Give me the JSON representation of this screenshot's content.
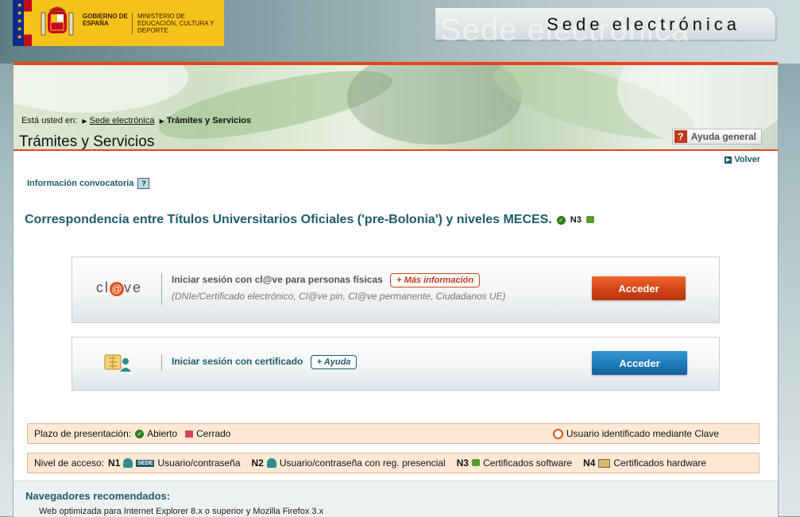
{
  "header": {
    "gobierno": "GOBIERNO DE ESPAÑA",
    "ministerio": "MINISTERIO DE EDUCACIÓN, CULTURA Y DEPORTE",
    "site_title": "Sede electrónica",
    "site_title_ghost": "Sede electrónica"
  },
  "breadcrumb": {
    "prefix": "Está usted en:",
    "items": [
      "Sede electrónica",
      "Trámites y Servicios"
    ]
  },
  "page": {
    "title": "Trámites y Servicios",
    "help_label": "Ayuda general",
    "help_icon": "?",
    "back_label": "Volver",
    "info_label": "Información convocatoria",
    "info_icon": "?",
    "procedure_title": "Correspondencia entre Títulos Universitarios Oficiales ('pre-Bolonia') y niveles MECES.",
    "procedure_level": "N3"
  },
  "login_clave": {
    "logo_pre": "cl",
    "logo_at": "@",
    "logo_post": "ve",
    "title": "Iniciar sesión con cl@ve para personas físicas",
    "more_info": "+ Más información",
    "subtitle": "(DNIe/Certificado electrónico, Cl@ve pin, Cl@ve permanente, Ciudadanos UE)",
    "button": "Acceder"
  },
  "login_cert": {
    "title": "Iniciar sesión con certificado",
    "help": "+ Ayuda",
    "button": "Acceder"
  },
  "legend_plazo": {
    "label": "Plazo de presentación:",
    "open": "Abierto",
    "closed": "Cerrado",
    "clave_user": "Usuario identificado mediante Clave"
  },
  "legend_nivel": {
    "label": "Nivel de acceso:",
    "n1": "N1",
    "n1_badge": "SEDE",
    "n1_text": "Usuario/contraseña",
    "n2": "N2",
    "n2_text": "Usuario/contraseña con reg. presencial",
    "n3": "N3",
    "n3_text": "Certificados software",
    "n4": "N4",
    "n4_text": "Certificados hardware"
  },
  "footer": {
    "title": "Navegadores recomendados:",
    "text": "Web optimizada para Internet Explorer 8.x o superior y Mozilla Firefox 3.x"
  },
  "colors": {
    "accent": "#e2471c",
    "teal": "#1e5b6d",
    "button_red": "#d1431a",
    "button_blue": "#1f79b9",
    "legend_bg": "#fde8d6"
  }
}
